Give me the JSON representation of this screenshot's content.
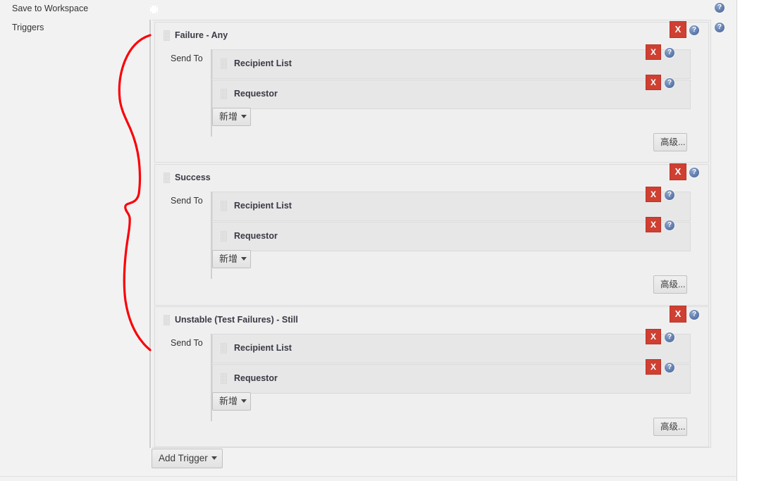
{
  "page": {
    "form_fields": [
      {
        "label": "Save to Workspace",
        "control": "checkbox",
        "checked": false
      },
      {
        "label": "Triggers",
        "control": "triggers-panel"
      }
    ]
  },
  "right_rail": {
    "help_icons": [
      {
        "icon": "help-icon"
      },
      {
        "icon": "help-icon"
      }
    ]
  },
  "annotation": {
    "type": "hand-drawn-brace",
    "color": "#fb0007",
    "spans": "all three trigger blocks"
  },
  "icons": {
    "drag_handle": "drag-handle-icon",
    "help": "help-icon",
    "delete": "delete-x-icon",
    "caret": "chevron-down-icon"
  },
  "colors": {
    "delete_button": "#cf4032",
    "delete_button_border": "#b93527",
    "help_icon": "#44618f",
    "panel_bg": "#efefef",
    "row_bg": "#e7e7e7",
    "page_bg": "#f2f2f2",
    "annotation_red": "#fb0007"
  },
  "triggers": {
    "send_to_label": "Send To",
    "add_label": "新增",
    "advanced_label": "高级...",
    "delete_label": "X",
    "add_trigger_label": "Add Trigger",
    "blocks": [
      {
        "title": "Failure - Any",
        "recipients": [
          {
            "name": "Recipient List"
          },
          {
            "name": "Requestor"
          }
        ]
      },
      {
        "title": "Success",
        "recipients": [
          {
            "name": "Recipient List"
          },
          {
            "name": "Requestor"
          }
        ]
      },
      {
        "title": "Unstable (Test Failures) - Still",
        "recipients": [
          {
            "name": "Recipient List"
          },
          {
            "name": "Requestor"
          }
        ]
      }
    ]
  }
}
